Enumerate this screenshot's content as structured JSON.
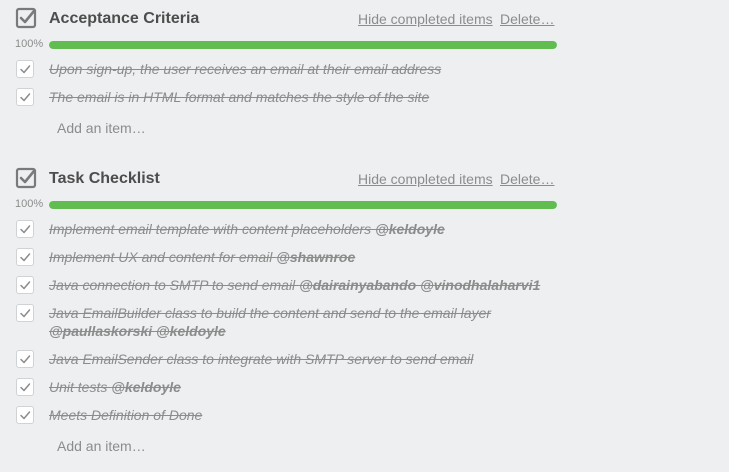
{
  "checklists": [
    {
      "title": "Acceptance Criteria",
      "hide_label": "Hide completed items",
      "delete_label": "Delete…",
      "progress_text": "100%",
      "progress_value": 1.0,
      "items": [
        {
          "text": "Upon sign-up, the user receives an email at their email address",
          "mentions": ""
        },
        {
          "text": "The email is in HTML format and matches the style of the site",
          "mentions": ""
        }
      ],
      "add_label": "Add an item…"
    },
    {
      "title": "Task Checklist",
      "hide_label": "Hide completed items",
      "delete_label": "Delete…",
      "progress_text": "100%",
      "progress_value": 1.0,
      "items": [
        {
          "text": "Implement email template with content placeholders ",
          "mentions": "@keldoyle"
        },
        {
          "text": "Implement UX and content for email ",
          "mentions": "@shawnroe"
        },
        {
          "text": "Java connection to SMTP to send email ",
          "mentions": "@dairainyabando @vinodhalaharvi1"
        },
        {
          "text": "Java EmailBuilder class to build the content and send to the email layer ",
          "mentions": "@paullaskorski @keldoyle"
        },
        {
          "text": "Java EmailSender class to integrate with SMTP server to send email",
          "mentions": ""
        },
        {
          "text": "Unit tests ",
          "mentions": "@keldoyle"
        },
        {
          "text": "Meets Definition of Done",
          "mentions": ""
        }
      ],
      "add_label": "Add an item…"
    }
  ],
  "colors": {
    "progress_fill": "#61bd4f",
    "background": "#edeff0"
  },
  "icons": {
    "title_icon": "checkbox-checked-icon",
    "item_icon": "check-icon"
  }
}
